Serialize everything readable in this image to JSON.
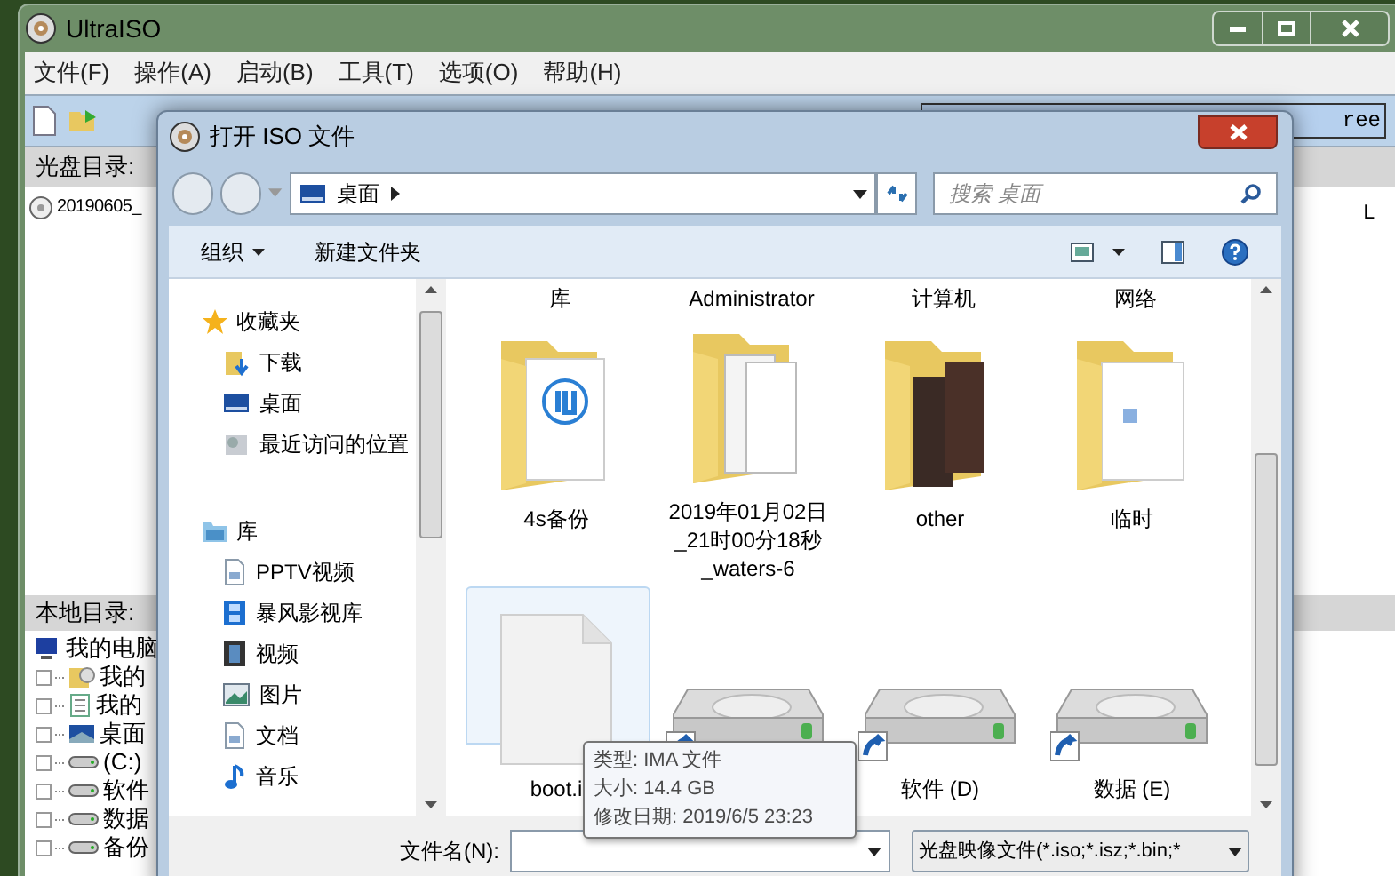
{
  "app_window": {
    "title": "UltraISO",
    "menu": [
      "文件(F)",
      "操作(A)",
      "启动(B)",
      "工具(T)",
      "选项(O)",
      "帮助(H)"
    ],
    "toolbar_text": "ree",
    "disc_panel": {
      "header": "光盘目录:",
      "items": [
        "20190605_"
      ],
      "column_3": "L"
    },
    "local_panel": {
      "header": "本地目录:",
      "tree": [
        {
          "label": "我的电脑",
          "children": [
            {
              "label": "我的"
            },
            {
              "label": "我的"
            },
            {
              "label": "桌面"
            },
            {
              "label": "(C:)"
            },
            {
              "label": "软件"
            },
            {
              "label": "数据"
            },
            {
              "label": "备份"
            }
          ]
        }
      ]
    }
  },
  "dialog": {
    "title": "打开 ISO 文件",
    "address": "桌面",
    "search": {
      "placeholder": "搜索 桌面"
    },
    "toolbar": {
      "organize": "组织",
      "new_folder": "新建文件夹"
    },
    "nav_pane": [
      {
        "label": "收藏夹",
        "children": [
          {
            "label": "下载"
          },
          {
            "label": "桌面"
          },
          {
            "label": "最近访问的位置"
          }
        ]
      },
      {
        "label": "库",
        "children": [
          {
            "label": "PPTV视频"
          },
          {
            "label": "暴风影视库"
          },
          {
            "label": "视频"
          },
          {
            "label": "图片"
          },
          {
            "label": "文档"
          },
          {
            "label": "音乐"
          }
        ]
      }
    ],
    "top_labels": [
      "库",
      "Administrator",
      "计算机",
      "网络"
    ],
    "items": [
      {
        "name": "4s备份",
        "kind": "folder",
        "selected": false
      },
      {
        "name": "2019年01月02日_21时00分18秒_waters-6",
        "kind": "folder",
        "selected": false
      },
      {
        "name": "other",
        "kind": "folder",
        "selected": false
      },
      {
        "name": "临时",
        "kind": "folder",
        "selected": false
      },
      {
        "name": "boot.i",
        "kind": "file",
        "selected": true
      },
      {
        "kind": "drive",
        "selected": false
      },
      {
        "name": "软件 (D)",
        "kind": "drive",
        "selected": false
      },
      {
        "name": "数据 (E)",
        "kind": "drive",
        "selected": false
      }
    ],
    "tooltip": [
      "类型: IMA 文件",
      "大小: 14.4 GB",
      "修改日期: 2019/6/5 23:23"
    ],
    "filename": {
      "label": "文件名(N):"
    },
    "filter": "光盘映像文件(*.iso;*.isz;*.bin;*"
  }
}
